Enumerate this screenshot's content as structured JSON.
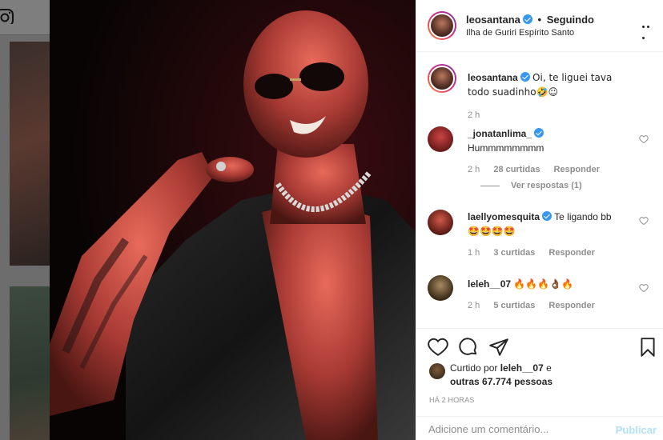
{
  "colors": {
    "verified": "#3897f0",
    "link_muted": "#8e8e8e",
    "publish_disabled": "#b2dffc"
  },
  "icons": {
    "brand": "instagram-icon",
    "more": "more-dots-icon",
    "like": "heart-icon",
    "comment": "comment-icon",
    "share": "share-icon",
    "save": "bookmark-icon"
  },
  "post": {
    "username": "leosantana",
    "separator": "•",
    "follow_status": "Seguindo",
    "location": "Ilha de Guriri Espírito Santo"
  },
  "caption": {
    "username": "leosantana",
    "text": "Oi, te liguei tava todo suadinho🤣☺",
    "time": "2 h"
  },
  "comments": [
    {
      "username": "_jonatanlima_",
      "text": "Hummmmmmmm",
      "time": "2 h",
      "likes": "28 curtidas",
      "reply": "Responder",
      "view_replies": "Ver respostas (1)"
    },
    {
      "username": "laellyomesquita",
      "text": "Te ligando bb",
      "text2": "🤩🤩🤩🤩",
      "time": "1 h",
      "likes": "3 curtidas",
      "reply": "Responder"
    },
    {
      "username": "leleh__07",
      "text": "🔥🔥🔥👌🏾🔥",
      "time": "2 h",
      "likes": "5 curtidas",
      "reply": "Responder"
    }
  ],
  "likes": {
    "prefix": "Curtido por",
    "user": "leleh__07",
    "middle": "e",
    "others_prefix": "outras",
    "count": "67.774",
    "suffix": "pessoas"
  },
  "timestamp": "HÁ 2 HORAS",
  "add_comment": {
    "placeholder": "Adicione um comentário...",
    "button": "Publicar"
  }
}
